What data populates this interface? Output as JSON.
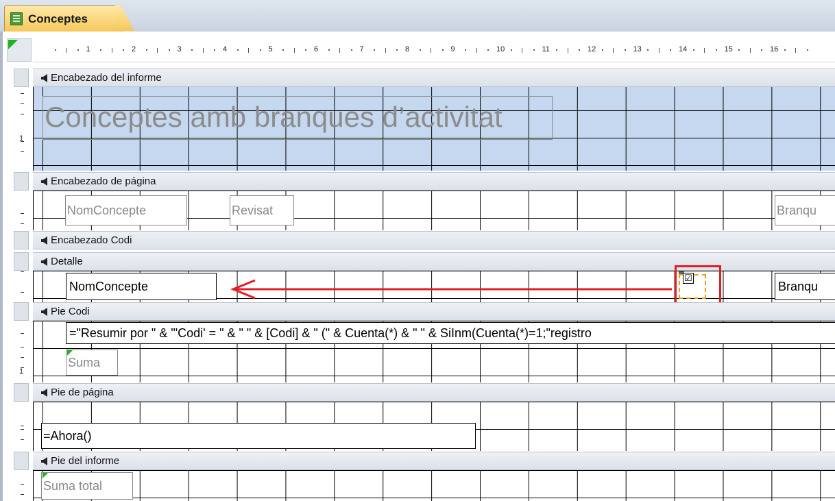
{
  "document_tab": {
    "title": "Conceptes"
  },
  "ruler": {
    "numbers": [
      "1",
      "2",
      "3",
      "4",
      "5",
      "6",
      "7",
      "8",
      "9",
      "10",
      "11",
      "12",
      "13",
      "14",
      "15",
      "16"
    ]
  },
  "vertical_ruler": {
    "numbers": [
      "1",
      "1"
    ]
  },
  "sections": {
    "report_header": {
      "title": "Encabezado del informe",
      "report_title": "Conceptes amb branques d’activitat"
    },
    "page_header": {
      "title": "Encabezado de página",
      "labels": [
        "NomConcepte",
        "Revisat",
        "Branqu"
      ]
    },
    "group_header": {
      "title": "Encabezado Codi"
    },
    "detail": {
      "title": "Detalle",
      "field_name": "NomConcepte",
      "field_branch": "Branqu",
      "checkbox_mark": "☑"
    },
    "group_footer": {
      "title": "Pie Codi",
      "summary_expr": "=\"Resumir por \" & \"'Codi' = \" & \" \" & [Codi] & \" (\" & Cuenta(*) & \" \" & SiInm(Cuenta(*)=1;\"registro",
      "sum_label": "Suma"
    },
    "page_footer": {
      "title": "Pie de página",
      "now_expr": "=Ahora()"
    },
    "report_footer": {
      "title": "Pie del informe",
      "total_label": "Suma total"
    }
  },
  "colors": {
    "highlight_red": "#e31e24",
    "selection_orange": "#f39c12",
    "report_header_blue": "#c5d8ef"
  }
}
